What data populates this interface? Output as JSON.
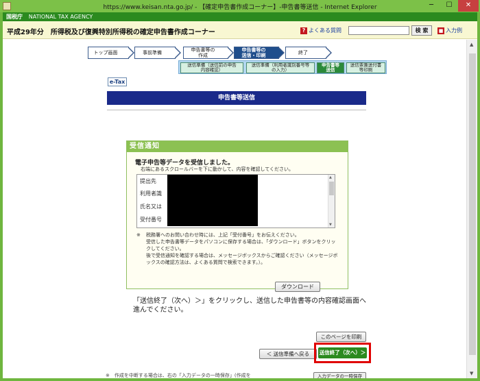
{
  "window": {
    "title": "https://www.keisan.nta.go.jp/ - 【確定申告書作成コーナー】-申告書等送信 - Internet Explorer",
    "minimize": "─",
    "maximize": "☐",
    "close": "✕"
  },
  "site": {
    "agency_jp": "国税庁",
    "agency_en": "NATIONAL TAX AGENCY",
    "heading": "平成29年分　所得税及び復興特別所得税の確定申告書作成コーナー",
    "faq_label": "よくある質問",
    "search_button": "検 索",
    "help_label": "入力例"
  },
  "steps": [
    "トップ画面",
    "事前準備",
    "申告書等の\n作成",
    "申告書等の\n送信・印刷",
    "終了"
  ],
  "substeps": [
    "送信準備（送信前の申告\n内容確認）",
    "送信準備（利用者識別番号等\nの入力）",
    "申告書等\n送信",
    "送信票兼送付書\n等印刷"
  ],
  "etax_label": "e-Tax",
  "page_title": "申告書等送信",
  "panel": {
    "header": "受信通知",
    "title": "電子申告等データを受信しました。",
    "note": "右端にあるスクロールバーを下に動かして、内容を確認してください。",
    "rows": [
      "提出先",
      "利用者識",
      "氏名又は",
      "受付番号"
    ],
    "notes_mark": "※",
    "notes": [
      "税務署へのお問い合わせ時には、上記「受付番号」をお伝えください。",
      "受信した申告書等データをパソコンに保存する場合は、「ダウンロード」ボタンをクリックしてください。",
      "後で受信通知を確認する場合は、メッセージボックスからご確認ください（メッセージボックスの確認方法は、よくある質問で検索できます。）。"
    ],
    "download_button": "ダウンロード"
  },
  "instruction": "「送信終了（次へ）＞」をクリックし、送信した申告書等の内容確認画面へ進んでください。",
  "buttons": {
    "print": "このページを印刷",
    "back": "＜ 送信準備へ戻る",
    "next": "送信終了（次へ）＞"
  },
  "footer": {
    "note": "※　作成を中断する場合は、右の「入力データの一時保存」(作成を",
    "button": "入力データの一時保存"
  },
  "colors": {
    "frame": "#6fb63f",
    "site_green": "#2b8a1f",
    "nav_blue": "#1a2a8a",
    "highlight_red": "#e00000"
  }
}
